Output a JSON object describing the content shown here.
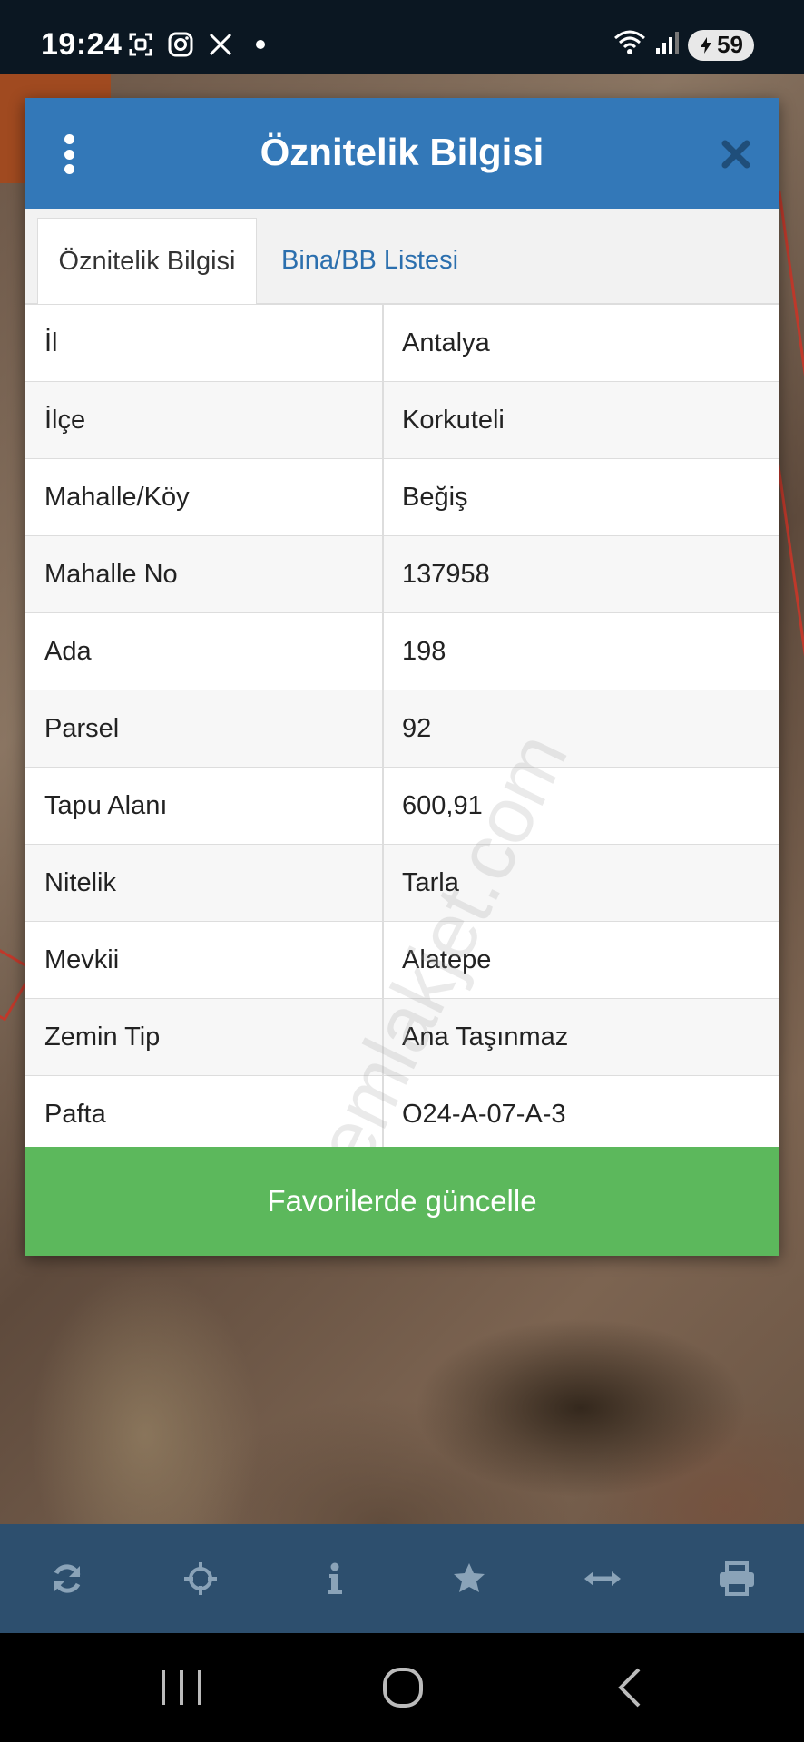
{
  "status_bar": {
    "time": "19:24",
    "battery": "59",
    "left_icons": [
      "screenshot-icon",
      "instagram-icon",
      "x-icon",
      "dot-icon"
    ],
    "right_icons": [
      "wifi-icon",
      "signal-icon",
      "battery-icon"
    ]
  },
  "dialog": {
    "title": "Öznitelik Bilgisi",
    "tabs": [
      {
        "label": "Öznitelik Bilgisi",
        "active": true
      },
      {
        "label": "Bina/BB Listesi",
        "active": false
      }
    ],
    "rows": [
      {
        "key": "İl",
        "value": "Antalya"
      },
      {
        "key": "İlçe",
        "value": "Korkuteli"
      },
      {
        "key": "Mahalle/Köy",
        "value": "Beğiş"
      },
      {
        "key": "Mahalle No",
        "value": "137958"
      },
      {
        "key": "Ada",
        "value": "198"
      },
      {
        "key": "Parsel",
        "value": "92"
      },
      {
        "key": "Tapu Alanı",
        "value": "600,91"
      },
      {
        "key": "Nitelik",
        "value": "Tarla"
      },
      {
        "key": "Mevkii",
        "value": "Alatepe"
      },
      {
        "key": "Zemin Tip",
        "value": "Ana Taşınmaz"
      },
      {
        "key": "Pafta",
        "value": "O24-A-07-A-3"
      }
    ],
    "button_label": "Favorilerde güncelle"
  },
  "watermark": "emlakjet.com",
  "toolbar": {
    "icons": [
      "refresh-icon",
      "locate-icon",
      "info-icon",
      "star-icon",
      "measure-icon",
      "print-icon"
    ]
  },
  "colors": {
    "header": "#3378b8",
    "button": "#5cb85c",
    "toolbar": "#2d4f6e",
    "tab_link": "#2b6fae"
  }
}
